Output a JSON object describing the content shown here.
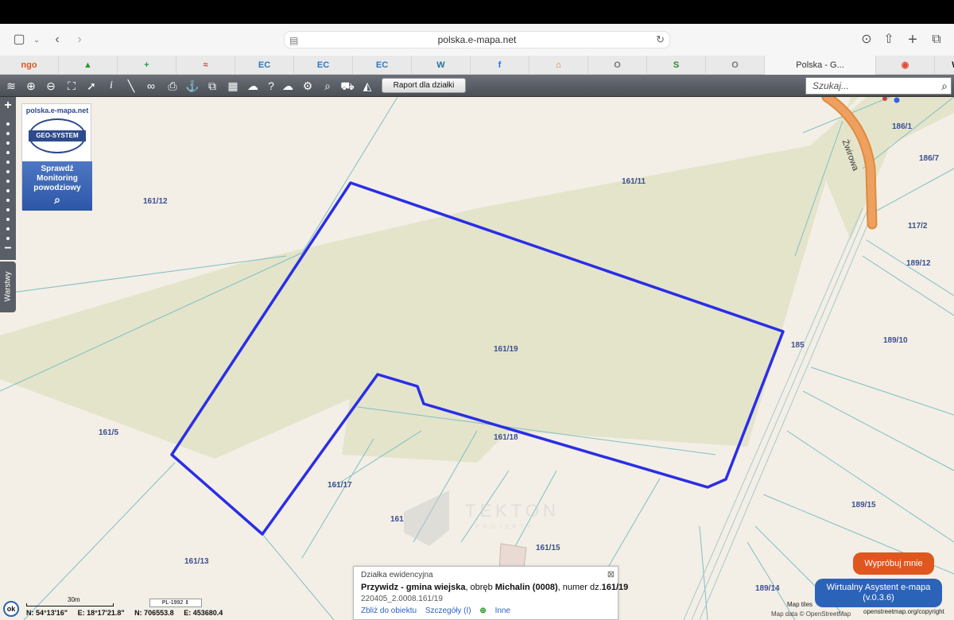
{
  "browser": {
    "url": "polska.e-mapa.net",
    "tabs": [
      {
        "fav": "ngo",
        "color": "#e0561f"
      },
      {
        "fav": "▲",
        "color": "#2a9a2a"
      },
      {
        "fav": "+",
        "color": "#1e9e4a"
      },
      {
        "fav": "≈",
        "color": "#c44"
      },
      {
        "fav": "EC",
        "color": "#2b7bbf"
      },
      {
        "fav": "EC",
        "color": "#2b7bbf"
      },
      {
        "fav": "EC",
        "color": "#2b7bbf"
      },
      {
        "fav": "W",
        "color": "#21759b"
      },
      {
        "fav": "f",
        "color": "#1877f2"
      },
      {
        "fav": "⌂",
        "color": "#e86a3a"
      },
      {
        "fav": "O",
        "color": "#777"
      },
      {
        "fav": "S",
        "color": "#2a8a2a"
      },
      {
        "fav": "O",
        "color": "#777"
      },
      {
        "fav": "Polska - G...",
        "color": "#333"
      },
      {
        "fav": "◉",
        "color": "#e04a3a"
      },
      {
        "fav": "W",
        "color": "#111"
      }
    ]
  },
  "toolbar": {
    "raport_label": "Raport dla działki",
    "search_placeholder": "Szukaj..."
  },
  "sidebar": {
    "warstwy_label": "Warstwy",
    "logo_site": "polska.e-mapa.net",
    "logo_brand": "GEO-SYSTEM",
    "flood_line1": "Sprawdź",
    "flood_line2": "Monitoring",
    "flood_line3": "powodziowy"
  },
  "map": {
    "street": "Żwirowa",
    "parcels": [
      {
        "id": "161/12"
      },
      {
        "id": "161/11"
      },
      {
        "id": "186/1"
      },
      {
        "id": "186/7"
      },
      {
        "id": "117/2"
      },
      {
        "id": "189/12"
      },
      {
        "id": "161/19"
      },
      {
        "id": "185"
      },
      {
        "id": "189/10"
      },
      {
        "id": "161/5"
      },
      {
        "id": "161/18"
      },
      {
        "id": "161/17"
      },
      {
        "id": "189/15"
      },
      {
        "id": "161"
      },
      {
        "id": "161/15"
      },
      {
        "id": "161/13"
      },
      {
        "id": "189/14"
      }
    ],
    "watermark": "TEKTON",
    "watermark_sub": "PROJEKTY",
    "highlight_color": "#2a2ee6",
    "field_color": "#e4e4cb"
  },
  "infobox": {
    "header": "Działka ewidencyjna",
    "name_bold": "Przywidz - gmina wiejska",
    "sep1": ", obręb ",
    "obreb_bold": "Michalin (0008)",
    "sep2": ", numer dz.",
    "number_bold": "161/19",
    "teryt": "220405_2.0008.161/19",
    "link_zoom": "Zbliż do obiektu",
    "link_details": "Szczegóły (I)",
    "link_other": "Inne"
  },
  "assistant": {
    "try_label": "Wypróbuj mnie",
    "line1": "Wirtualny Asystent e-mapa",
    "line2": "(v.0.3.6)"
  },
  "status": {
    "ok": "ok",
    "scale": "30m",
    "crs": "PL-1992",
    "lat": "N: 54°13'16\"",
    "lon": "E: 18°17'21.8\"",
    "n": "N: 706553.8",
    "e": "E: 453680.4",
    "attrib_tiles": "Map tiles",
    "attrib_data": "Map data © OpenStreetMap",
    "attrib_url": "openstreetmap.org/copyright"
  }
}
